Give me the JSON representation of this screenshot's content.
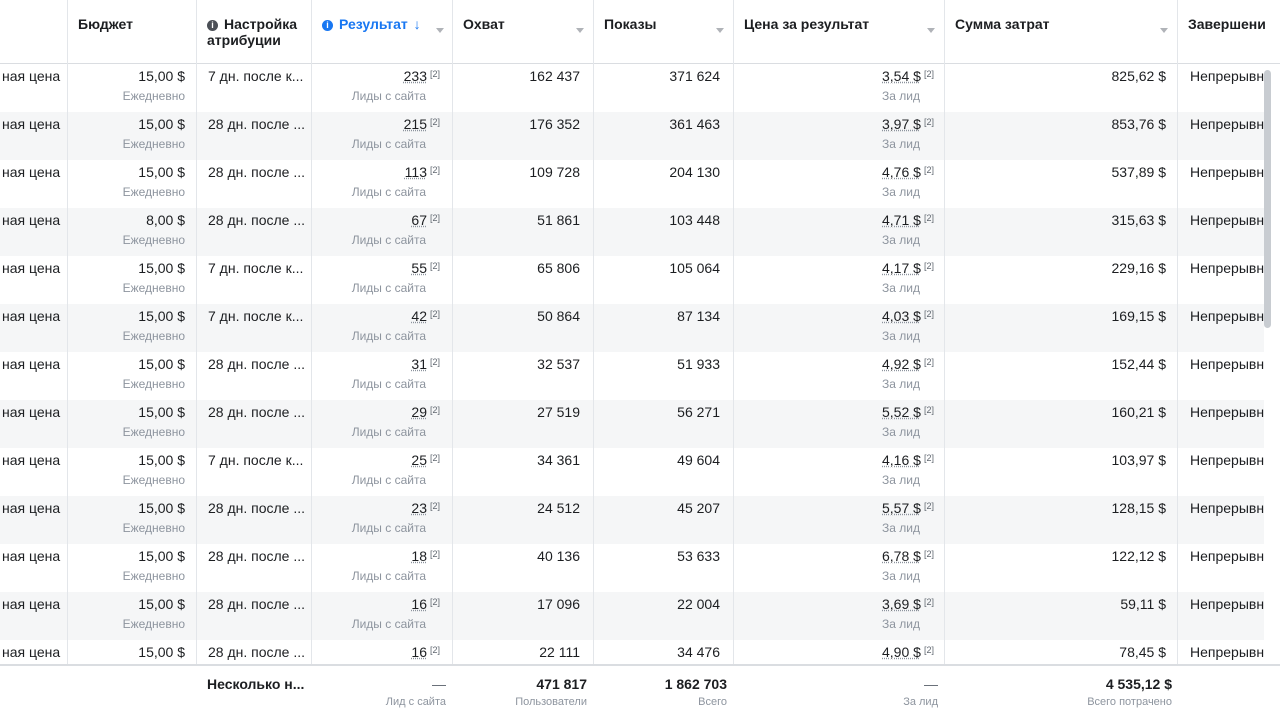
{
  "columns": {
    "budget": "Бюджет",
    "attribution": "Настройка атрибуции",
    "result": "Результат",
    "reach": "Охват",
    "impressions": "Показы",
    "cost_per_result": "Цена за результат",
    "amount_spent": "Сумма затрат",
    "ends": "Завершени"
  },
  "rows": [
    {
      "bid": "ная цена",
      "budget": "15,00 $",
      "budget_sub": "Ежедневно",
      "attr": "7 дн. после к...",
      "result": "233",
      "result_sub": "Лиды с сайта",
      "reach": "162 437",
      "impr": "371 624",
      "cpr": "3,54 $",
      "cpr_sub": "За лид",
      "spent": "825,62 $",
      "ends": "Непрерывн"
    },
    {
      "bid": "ная цена",
      "budget": "15,00 $",
      "budget_sub": "Ежедневно",
      "attr": "28 дн. после ...",
      "result": "215",
      "result_sub": "Лиды с сайта",
      "reach": "176 352",
      "impr": "361 463",
      "cpr": "3,97 $",
      "cpr_sub": "За лид",
      "spent": "853,76 $",
      "ends": "Непрерывн"
    },
    {
      "bid": "ная цена",
      "budget": "15,00 $",
      "budget_sub": "Ежедневно",
      "attr": "28 дн. после ...",
      "result": "113",
      "result_sub": "Лиды с сайта",
      "reach": "109 728",
      "impr": "204 130",
      "cpr": "4,76 $",
      "cpr_sub": "За лид",
      "spent": "537,89 $",
      "ends": "Непрерывн"
    },
    {
      "bid": "ная цена",
      "budget": "8,00 $",
      "budget_sub": "Ежедневно",
      "attr": "28 дн. после ...",
      "result": "67",
      "result_sub": "Лиды с сайта",
      "reach": "51 861",
      "impr": "103 448",
      "cpr": "4,71 $",
      "cpr_sub": "За лид",
      "spent": "315,63 $",
      "ends": "Непрерывн"
    },
    {
      "bid": "ная цена",
      "budget": "15,00 $",
      "budget_sub": "Ежедневно",
      "attr": "7 дн. после к...",
      "result": "55",
      "result_sub": "Лиды с сайта",
      "reach": "65 806",
      "impr": "105 064",
      "cpr": "4,17 $",
      "cpr_sub": "За лид",
      "spent": "229,16 $",
      "ends": "Непрерывн"
    },
    {
      "bid": "ная цена",
      "budget": "15,00 $",
      "budget_sub": "Ежедневно",
      "attr": "7 дн. после к...",
      "result": "42",
      "result_sub": "Лиды с сайта",
      "reach": "50 864",
      "impr": "87 134",
      "cpr": "4,03 $",
      "cpr_sub": "За лид",
      "spent": "169,15 $",
      "ends": "Непрерывн..."
    },
    {
      "bid": "ная цена",
      "budget": "15,00 $",
      "budget_sub": "Ежедневно",
      "attr": "28 дн. после ...",
      "result": "31",
      "result_sub": "Лиды с сайта",
      "reach": "32 537",
      "impr": "51 933",
      "cpr": "4,92 $",
      "cpr_sub": "За лид",
      "spent": "152,44 $",
      "ends": "Непрерывн..."
    },
    {
      "bid": "ная цена",
      "budget": "15,00 $",
      "budget_sub": "Ежедневно",
      "attr": "28 дн. после ...",
      "result": "29",
      "result_sub": "Лиды с сайта",
      "reach": "27 519",
      "impr": "56 271",
      "cpr": "5,52 $",
      "cpr_sub": "За лид",
      "spent": "160,21 $",
      "ends": "Непрерывн..."
    },
    {
      "bid": "ная цена",
      "budget": "15,00 $",
      "budget_sub": "Ежедневно",
      "attr": "7 дн. после к...",
      "result": "25",
      "result_sub": "Лиды с сайта",
      "reach": "34 361",
      "impr": "49 604",
      "cpr": "4,16 $",
      "cpr_sub": "За лид",
      "spent": "103,97 $",
      "ends": "Непрерывн..."
    },
    {
      "bid": "ная цена",
      "budget": "15,00 $",
      "budget_sub": "Ежедневно",
      "attr": "28 дн. после ...",
      "result": "23",
      "result_sub": "Лиды с сайта",
      "reach": "24 512",
      "impr": "45 207",
      "cpr": "5,57 $",
      "cpr_sub": "За лид",
      "spent": "128,15 $",
      "ends": "Непрерывн..."
    },
    {
      "bid": "ная цена",
      "budget": "15,00 $",
      "budget_sub": "Ежедневно",
      "attr": "28 дн. после ...",
      "result": "18",
      "result_sub": "Лиды с сайта",
      "reach": "40 136",
      "impr": "53 633",
      "cpr": "6,78 $",
      "cpr_sub": "За лид",
      "spent": "122,12 $",
      "ends": "Непрерывн..."
    },
    {
      "bid": "ная цена",
      "budget": "15,00 $",
      "budget_sub": "Ежедневно",
      "attr": "28 дн. после ...",
      "result": "16",
      "result_sub": "Лиды с сайта",
      "reach": "17 096",
      "impr": "22 004",
      "cpr": "3,69 $",
      "cpr_sub": "За лид",
      "spent": "59,11 $",
      "ends": "Непрерывн..."
    },
    {
      "bid": "ная цена",
      "budget": "15,00 $",
      "budget_sub": "",
      "attr": "28 дн. после ...",
      "result": "16",
      "result_sub": "",
      "reach": "22 111",
      "impr": "34 476",
      "cpr": "4,90 $",
      "cpr_sub": "",
      "spent": "78,45 $",
      "ends": "Непрерывн..."
    }
  ],
  "superscript": "[2]",
  "totals": {
    "attribution": "Несколько н...",
    "result": "—",
    "result_sub": "Лид с сайта",
    "reach": "471 817",
    "reach_sub": "Пользователи",
    "impressions": "1 862 703",
    "impressions_sub": "Всего",
    "cost_per_result": "—",
    "cost_per_result_sub": "За лид",
    "amount_spent": "4 535,12 $",
    "amount_spent_sub": "Всего потрачено"
  },
  "icons": {
    "info": "info-icon",
    "sort": "sort-down-arrow-icon",
    "caret": "caret-down-icon"
  },
  "colors": {
    "accent": "#1877f2",
    "row_alt": "#f5f6f7",
    "muted": "#8d949e",
    "border": "#e3e6ea"
  }
}
